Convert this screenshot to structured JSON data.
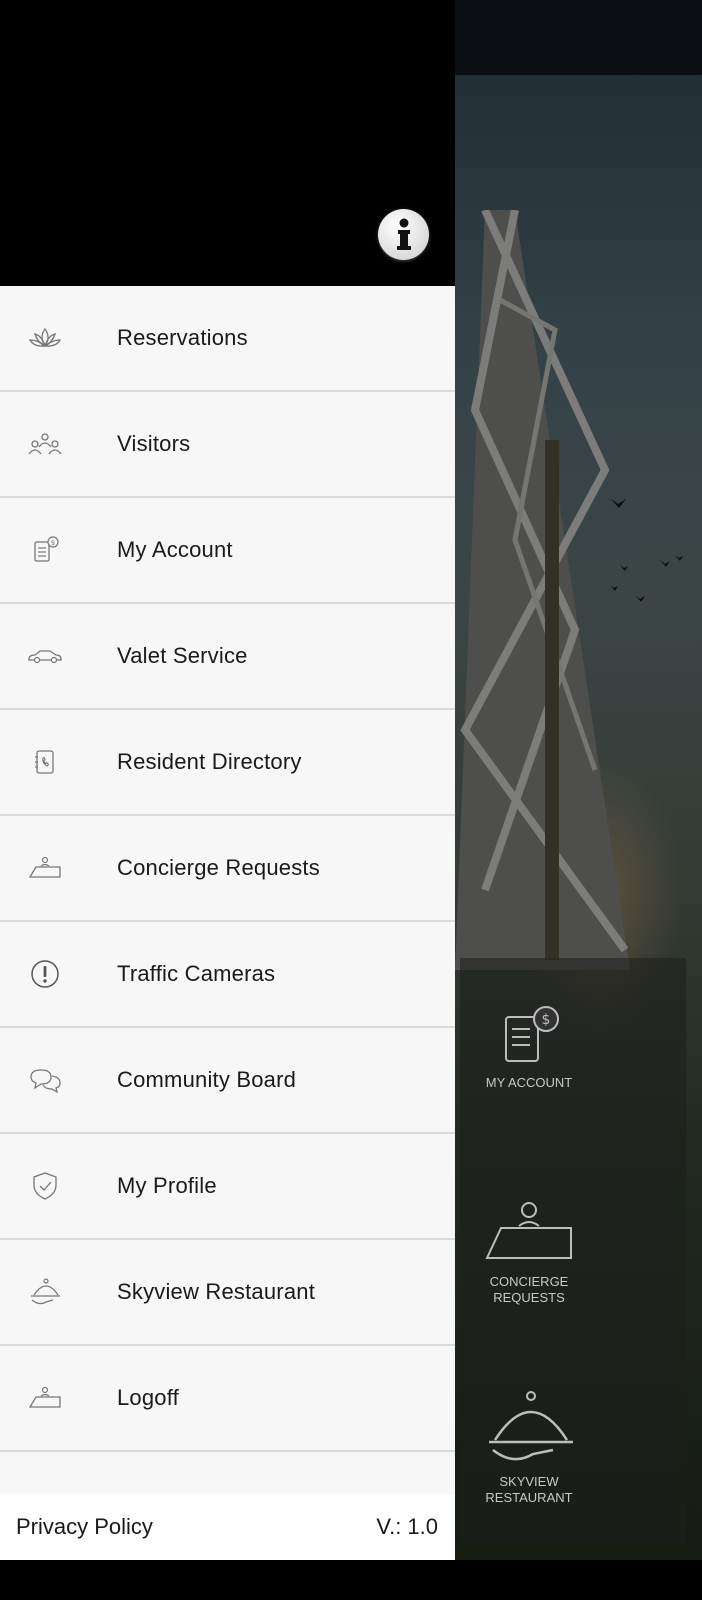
{
  "drawer": {
    "info_icon": "info-icon",
    "items": [
      {
        "label": "Reservations",
        "icon": "lotus-icon"
      },
      {
        "label": "Visitors",
        "icon": "people-group-icon"
      },
      {
        "label": "My Account",
        "icon": "invoice-dollar-icon"
      },
      {
        "label": "Valet Service",
        "icon": "car-icon"
      },
      {
        "label": "Resident Directory",
        "icon": "phone-book-icon"
      },
      {
        "label": "Concierge Requests",
        "icon": "concierge-desk-icon"
      },
      {
        "label": "Traffic Cameras",
        "icon": "alert-circle-icon"
      },
      {
        "label": "Community Board",
        "icon": "chat-bubbles-icon"
      },
      {
        "label": "My Profile",
        "icon": "shield-check-icon"
      },
      {
        "label": "Skyview Restaurant",
        "icon": "cloche-icon"
      },
      {
        "label": "Logoff",
        "icon": "concierge-desk-icon"
      }
    ],
    "footer": {
      "privacy_label": "Privacy Policy",
      "version_label": "V.: 1.0"
    }
  },
  "background": {
    "tiles": [
      {
        "label": "MY ACCOUNT",
        "icon": "invoice-dollar-icon"
      },
      {
        "label": "CONCIERGE REQUESTS",
        "icon": "concierge-desk-icon"
      },
      {
        "label": "SKYVIEW RESTAURANT",
        "icon": "cloche-icon"
      }
    ]
  },
  "colors": {
    "drawer_header": "#000000",
    "drawer_bg": "#f7f7f7",
    "divider": "#dadada",
    "text": "#1a1a1a",
    "tile_text": "#c9c9c9"
  }
}
